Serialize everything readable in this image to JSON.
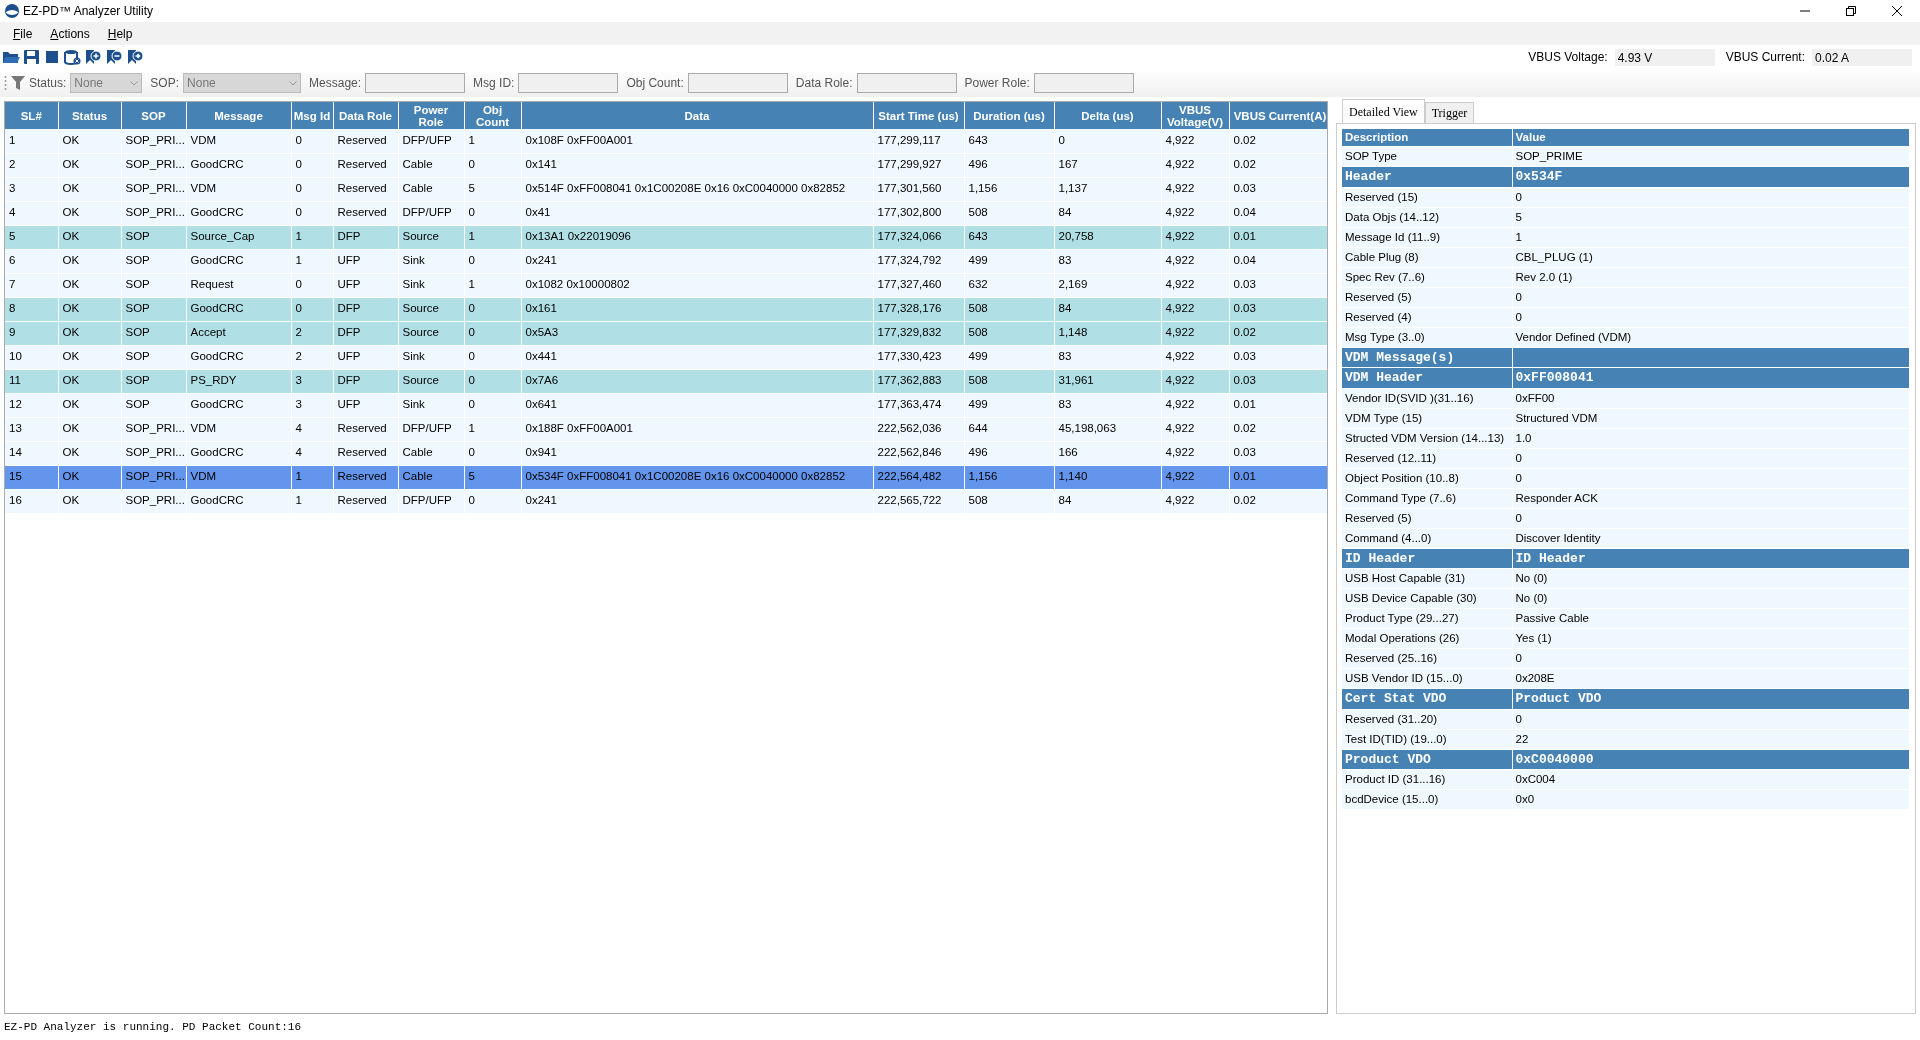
{
  "window": {
    "title": "EZ-PD™ Analyzer Utility"
  },
  "menu": [
    {
      "label": "File"
    },
    {
      "label": "Actions"
    },
    {
      "label": "Help"
    }
  ],
  "filters": [
    {
      "label": "Status:",
      "kind": "combo",
      "value": "None",
      "disabled": true
    },
    {
      "label": "SOP:",
      "kind": "combo",
      "value": "None",
      "disabled": true
    },
    {
      "label": "Message:",
      "kind": "field"
    },
    {
      "label": "Msg ID:",
      "kind": "field"
    },
    {
      "label": "Obj Count:",
      "kind": "field"
    },
    {
      "label": "Data Role:",
      "kind": "field"
    },
    {
      "label": "Power Role:",
      "kind": "field"
    }
  ],
  "vbus": [
    {
      "label": "VBUS Voltage:",
      "value": "4.93 V"
    },
    {
      "label": "VBUS Current:",
      "value": "0.02 A"
    }
  ],
  "table": {
    "columns": [
      "SL#",
      "Status",
      "SOP",
      "Message",
      "Msg Id",
      "Data Role",
      "Power Role",
      "Obj Count",
      "Data",
      "Start Time (us)",
      "Duration (us)",
      "Delta (us)",
      "VBUS Voltage(V)",
      "VBUS Current(A)"
    ],
    "rows": [
      {
        "cells": [
          "1",
          "OK",
          "SOP_PRI...",
          "VDM",
          "0",
          "Reserved",
          "DFP/UFP",
          "1",
          "0x108F 0xFF00A001",
          "177,299,117",
          "643",
          "0",
          "4,922",
          "0.02"
        ],
        "highlighted": false,
        "selected": false
      },
      {
        "cells": [
          "2",
          "OK",
          "SOP_PRI...",
          "GoodCRC",
          "0",
          "Reserved",
          "Cable",
          "0",
          "0x141",
          "177,299,927",
          "496",
          "167",
          "4,922",
          "0.02"
        ],
        "highlighted": false,
        "selected": false
      },
      {
        "cells": [
          "3",
          "OK",
          "SOP_PRI...",
          "VDM",
          "0",
          "Reserved",
          "Cable",
          "5",
          "0x514F 0xFF008041 0x1C00208E 0x16 0xC0040000 0x82852",
          "177,301,560",
          "1,156",
          "1,137",
          "4,922",
          "0.03"
        ],
        "highlighted": false,
        "selected": false
      },
      {
        "cells": [
          "4",
          "OK",
          "SOP_PRI...",
          "GoodCRC",
          "0",
          "Reserved",
          "DFP/UFP",
          "0",
          "0x41",
          "177,302,800",
          "508",
          "84",
          "4,922",
          "0.04"
        ],
        "highlighted": false,
        "selected": false
      },
      {
        "cells": [
          "5",
          "OK",
          "SOP",
          "Source_Cap",
          "1",
          "DFP",
          "Source",
          "1",
          "0x13A1 0x22019096",
          "177,324,066",
          "643",
          "20,758",
          "4,922",
          "0.01"
        ],
        "highlighted": true,
        "selected": false
      },
      {
        "cells": [
          "6",
          "OK",
          "SOP",
          "GoodCRC",
          "1",
          "UFP",
          "Sink",
          "0",
          "0x241",
          "177,324,792",
          "499",
          "83",
          "4,922",
          "0.04"
        ],
        "highlighted": false,
        "selected": false
      },
      {
        "cells": [
          "7",
          "OK",
          "SOP",
          "Request",
          "0",
          "UFP",
          "Sink",
          "1",
          "0x1082 0x10000802",
          "177,327,460",
          "632",
          "2,169",
          "4,922",
          "0.03"
        ],
        "highlighted": false,
        "selected": false
      },
      {
        "cells": [
          "8",
          "OK",
          "SOP",
          "GoodCRC",
          "0",
          "DFP",
          "Source",
          "0",
          "0x161",
          "177,328,176",
          "508",
          "84",
          "4,922",
          "0.03"
        ],
        "highlighted": true,
        "selected": false
      },
      {
        "cells": [
          "9",
          "OK",
          "SOP",
          "Accept",
          "2",
          "DFP",
          "Source",
          "0",
          "0x5A3",
          "177,329,832",
          "508",
          "1,148",
          "4,922",
          "0.02"
        ],
        "highlighted": true,
        "selected": false
      },
      {
        "cells": [
          "10",
          "OK",
          "SOP",
          "GoodCRC",
          "2",
          "UFP",
          "Sink",
          "0",
          "0x441",
          "177,330,423",
          "499",
          "83",
          "4,922",
          "0.03"
        ],
        "highlighted": false,
        "selected": false
      },
      {
        "cells": [
          "11",
          "OK",
          "SOP",
          "PS_RDY",
          "3",
          "DFP",
          "Source",
          "0",
          "0x7A6",
          "177,362,883",
          "508",
          "31,961",
          "4,922",
          "0.03"
        ],
        "highlighted": true,
        "selected": false
      },
      {
        "cells": [
          "12",
          "OK",
          "SOP",
          "GoodCRC",
          "3",
          "UFP",
          "Sink",
          "0",
          "0x641",
          "177,363,474",
          "499",
          "83",
          "4,922",
          "0.01"
        ],
        "highlighted": false,
        "selected": false
      },
      {
        "cells": [
          "13",
          "OK",
          "SOP_PRI...",
          "VDM",
          "4",
          "Reserved",
          "DFP/UFP",
          "1",
          "0x188F 0xFF00A001",
          "222,562,036",
          "644",
          "45,198,063",
          "4,922",
          "0.02"
        ],
        "highlighted": false,
        "selected": false
      },
      {
        "cells": [
          "14",
          "OK",
          "SOP_PRI...",
          "GoodCRC",
          "4",
          "Reserved",
          "Cable",
          "0",
          "0x941",
          "222,562,846",
          "496",
          "166",
          "4,922",
          "0.03"
        ],
        "highlighted": false,
        "selected": false
      },
      {
        "cells": [
          "15",
          "OK",
          "SOP_PRI...",
          "VDM",
          "1",
          "Reserved",
          "Cable",
          "5",
          "0x534F 0xFF008041 0x1C00208E 0x16 0xC0040000 0x82852",
          "222,564,482",
          "1,156",
          "1,140",
          "4,922",
          "0.01"
        ],
        "highlighted": false,
        "selected": true
      },
      {
        "cells": [
          "16",
          "OK",
          "SOP_PRI...",
          "GoodCRC",
          "1",
          "Reserved",
          "DFP/UFP",
          "0",
          "0x241",
          "222,565,722",
          "508",
          "84",
          "4,922",
          "0.02"
        ],
        "highlighted": false,
        "selected": false
      }
    ]
  },
  "details": {
    "tabs": [
      {
        "label": "Detailed View",
        "selected": true
      },
      {
        "label": "Trigger",
        "selected": false
      }
    ],
    "columns": [
      "Description",
      "Value"
    ],
    "rows": [
      {
        "kind": "field",
        "description": "SOP Type",
        "value": "SOP_PRIME"
      },
      {
        "kind": "section",
        "description": "Header",
        "value": "0x534F"
      },
      {
        "kind": "field",
        "description": "Reserved (15)",
        "value": "0"
      },
      {
        "kind": "field",
        "description": "Data Objs (14..12)",
        "value": "5"
      },
      {
        "kind": "field",
        "description": "Message Id (11..9)",
        "value": "1"
      },
      {
        "kind": "field",
        "description": "Cable Plug (8)",
        "value": "CBL_PLUG (1)"
      },
      {
        "kind": "field",
        "description": "Spec Rev (7..6)",
        "value": "Rev 2.0 (1)"
      },
      {
        "kind": "field",
        "description": "Reserved (5)",
        "value": "0"
      },
      {
        "kind": "field",
        "description": "Reserved (4)",
        "value": "0"
      },
      {
        "kind": "field",
        "description": "Msg Type (3..0)",
        "value": "Vendor Defined (VDM)"
      },
      {
        "kind": "section",
        "description": "VDM Message(s)"
      },
      {
        "kind": "section",
        "description": "VDM Header",
        "value": "0xFF008041"
      },
      {
        "kind": "field",
        "description": "Vendor ID(SVID )(31..16)",
        "value": "0xFF00"
      },
      {
        "kind": "field",
        "description": "VDM Type (15)",
        "value": "Structured VDM"
      },
      {
        "kind": "field",
        "description": "Structed VDM Version (14...13)",
        "value": "1.0"
      },
      {
        "kind": "field",
        "description": "Reserved (12..11)",
        "value": "0"
      },
      {
        "kind": "field",
        "description": "Object Position (10..8)",
        "value": "0"
      },
      {
        "kind": "field",
        "description": "Command Type (7..6)",
        "value": "Responder ACK"
      },
      {
        "kind": "field",
        "description": "Reserved (5)",
        "value": "0"
      },
      {
        "kind": "field",
        "description": "Command (4...0)",
        "value": "Discover Identity"
      },
      {
        "kind": "section",
        "description": "ID Header",
        "value": "ID Header"
      },
      {
        "kind": "field",
        "description": "USB Host Capable (31)",
        "value": "No (0)"
      },
      {
        "kind": "field",
        "description": "USB Device Capable (30)",
        "value": "No (0)"
      },
      {
        "kind": "field",
        "description": "Product Type (29...27)",
        "value": "Passive Cable"
      },
      {
        "kind": "field",
        "description": "Modal Operations (26)",
        "value": "Yes (1)"
      },
      {
        "kind": "field",
        "description": "Reserved (25..16)",
        "value": "0"
      },
      {
        "kind": "field",
        "description": "USB Vendor ID (15...0)",
        "value": "0x208E"
      },
      {
        "kind": "section",
        "description": "Cert Stat VDO",
        "value": "Product VDO"
      },
      {
        "kind": "field",
        "description": "Reserved (31..20)",
        "value": "0"
      },
      {
        "kind": "field",
        "description": "Test ID(TID) (19...0)",
        "value": "22"
      },
      {
        "kind": "section",
        "description": "Product VDO",
        "value": "0xC0040000"
      },
      {
        "kind": "field",
        "description": "Product ID (31...16)",
        "value": "0xC004"
      },
      {
        "kind": "field",
        "description": "bcdDevice (15...0)",
        "value": "0x0"
      }
    ]
  },
  "status_bar": {
    "text": "EZ-PD Analyzer is running. PD Packet Count:16"
  }
}
